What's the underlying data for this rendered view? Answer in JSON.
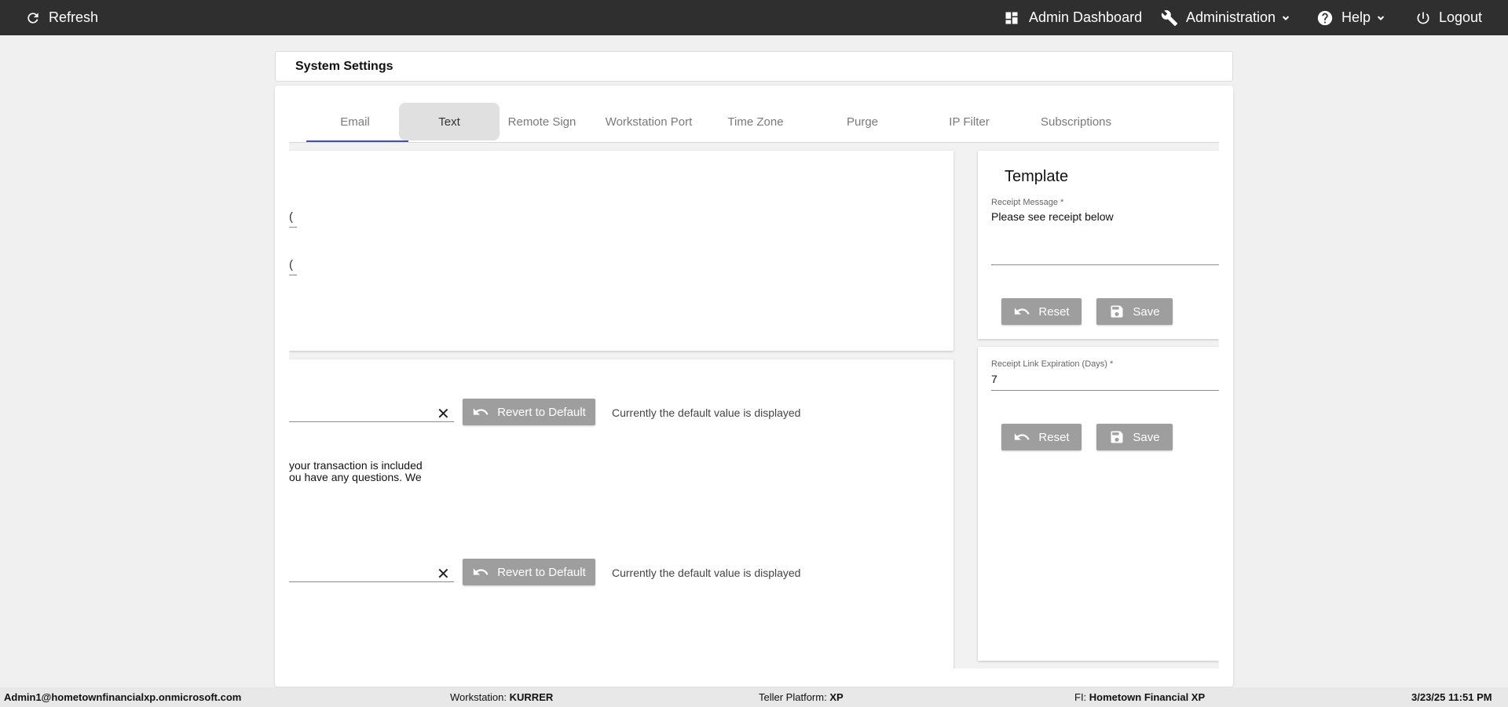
{
  "topbar": {
    "refresh": "Refresh",
    "admin_dashboard": "Admin Dashboard",
    "administration": "Administration",
    "help": "Help",
    "logout": "Logout"
  },
  "page": {
    "title": "System Settings"
  },
  "tabs": [
    {
      "label": "Email"
    },
    {
      "label": "Text"
    },
    {
      "label": "Remote Sign"
    },
    {
      "label": "Workstation Port"
    },
    {
      "label": "Time Zone"
    },
    {
      "label": "Purge"
    },
    {
      "label": "IP Filter"
    },
    {
      "label": "Subscriptions"
    }
  ],
  "active_tab": "Text",
  "left": {
    "clipped_glyph": "(",
    "revert_label": "Revert to Default",
    "default_note": "Currently the default value is displayed",
    "message_line1": "your transaction is included",
    "message_line2": "ou have any questions. We"
  },
  "template": {
    "title": "Template",
    "receipt_message_label": "Receipt Message *",
    "receipt_message_value": "Please see receipt below",
    "expiration_label": "Receipt Link Expiration (Days) *",
    "expiration_value": "7",
    "reset_label": "Reset",
    "save_label": "Save"
  },
  "footer": {
    "user": "Admin1@hometownfinancialxp.onmicrosoft.com",
    "workstation_label": "Workstation:",
    "workstation_value": "KURRER",
    "platform_label": "Teller Platform:",
    "platform_value": "XP",
    "fi_label": "FI:",
    "fi_value": "Hometown Financial XP",
    "datetime": "3/23/25 11:51 PM"
  },
  "colors": {
    "topbar": "#2f2f2f",
    "tab_indicator": "#3f51b5",
    "button_gray": "#9e9e9e"
  }
}
